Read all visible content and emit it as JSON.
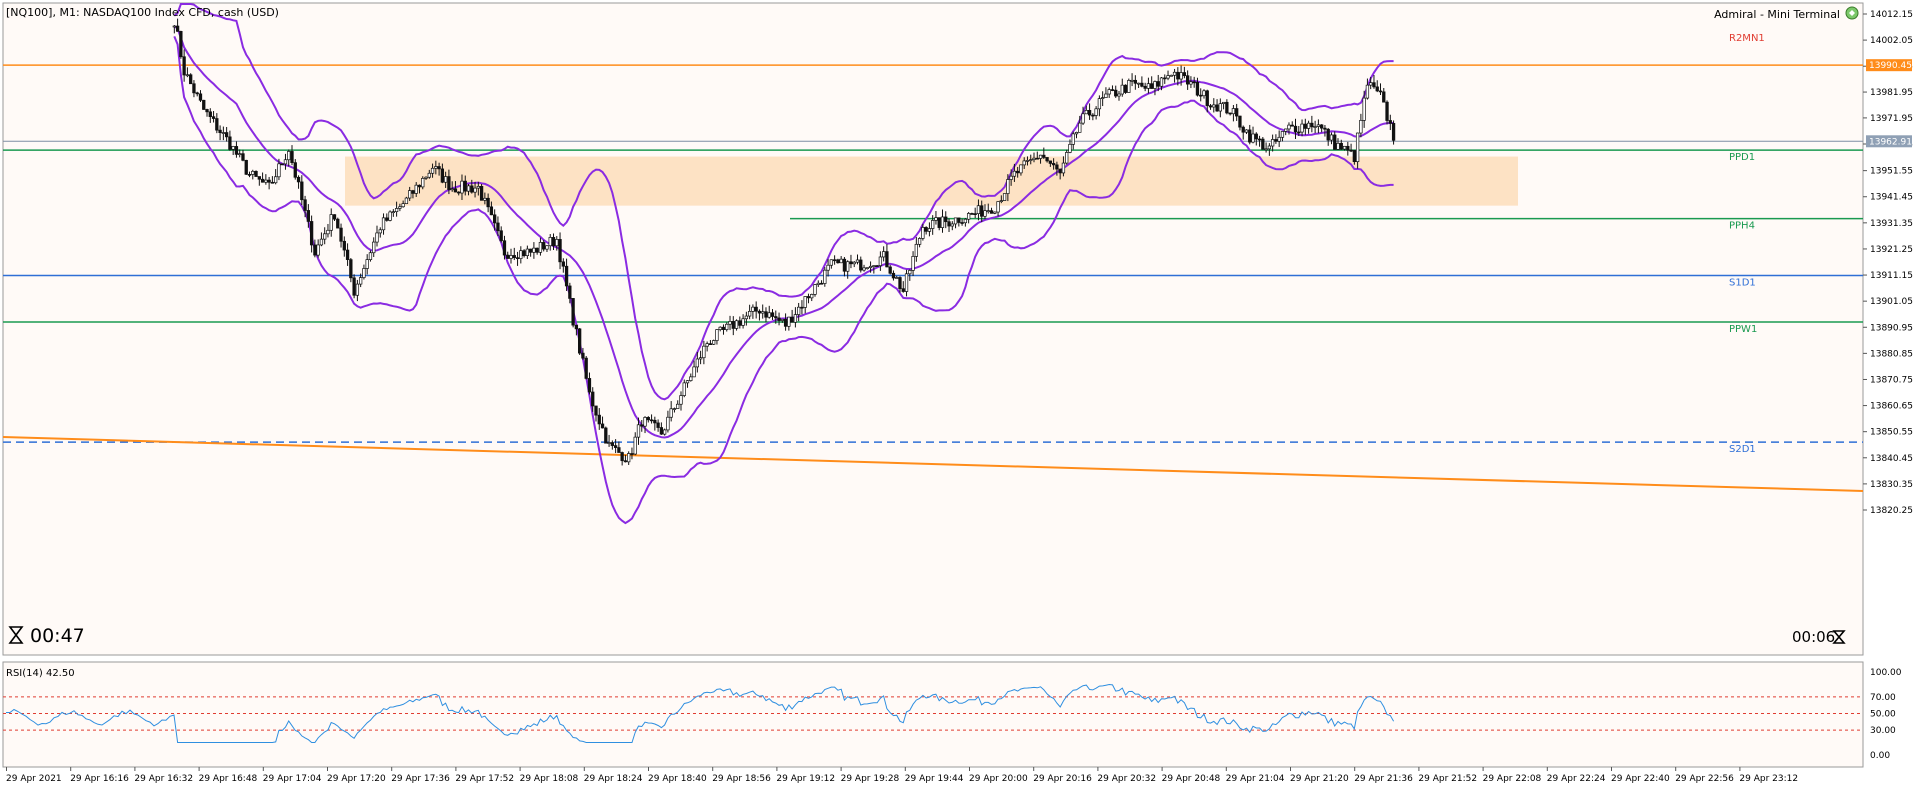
{
  "window": {
    "symbol_label": "[NQ100], M1:  NASDAQ100 Index CFD, cash (USD)",
    "terminal_label": "Admiral - Mini Terminal",
    "timer_left": "00:47",
    "timer_right": "00:06"
  },
  "colors": {
    "background": "#ffffff",
    "chart_bg": "#fffaf7",
    "band": "#8a2be2",
    "zone": "#fde2c4",
    "orange": "#ff8c1a",
    "green_level": "#1a9950",
    "blue_level": "#2f6fd6",
    "red_label": "#e03c31",
    "candle_up": "#ffffff",
    "candle_down": "#111111",
    "rsi_line": "#2f8fe0",
    "rsi_level": "#e03c31"
  },
  "chart_data": [
    {
      "type": "candlestick",
      "panel": "price",
      "ylim": [
        13815,
        14015
      ],
      "y_ticks": [
        "14012.15",
        "14002.05",
        "13991.95",
        "13981.95",
        "13971.95",
        "13961.85",
        "13951.55",
        "13941.45",
        "13931.35",
        "13921.25",
        "13911.15",
        "13901.05",
        "13890.95",
        "13880.85",
        "13870.75",
        "13860.65",
        "13850.55",
        "13840.45",
        "13830.35",
        "13820.25"
      ],
      "x_ticks": [
        "29 Apr 2021",
        "29 Apr 16:16",
        "29 Apr 16:32",
        "29 Apr 16:48",
        "29 Apr 17:04",
        "29 Apr 17:20",
        "29 Apr 17:36",
        "29 Apr 17:52",
        "29 Apr 18:08",
        "29 Apr 18:24",
        "29 Apr 18:40",
        "29 Apr 18:56",
        "29 Apr 19:12",
        "29 Apr 19:28",
        "29 Apr 19:44",
        "29 Apr 20:00",
        "29 Apr 20:16",
        "29 Apr 20:32",
        "29 Apr 20:48",
        "29 Apr 21:04",
        "29 Apr 21:20",
        "29 Apr 21:36",
        "29 Apr 21:52",
        "29 Apr 22:08",
        "29 Apr 22:24",
        "29 Apr 22:40",
        "29 Apr 22:56",
        "29 Apr 23:12"
      ],
      "price_path": [
        {
          "t": "16:47",
          "p": 14010
        },
        {
          "t": "16:50",
          "p": 13990
        },
        {
          "t": "16:56",
          "p": 13975
        },
        {
          "t": "17:04",
          "p": 13962
        },
        {
          "t": "17:10",
          "p": 13950
        },
        {
          "t": "17:16",
          "p": 13945
        },
        {
          "t": "17:22",
          "p": 13960
        },
        {
          "t": "17:30",
          "p": 13920
        },
        {
          "t": "17:36",
          "p": 13935
        },
        {
          "t": "17:42",
          "p": 13905
        },
        {
          "t": "17:50",
          "p": 13930
        },
        {
          "t": "17:58",
          "p": 13940
        },
        {
          "t": "18:06",
          "p": 13953
        },
        {
          "t": "18:12",
          "p": 13945
        },
        {
          "t": "18:20",
          "p": 13945
        },
        {
          "t": "18:28",
          "p": 13920
        },
        {
          "t": "18:36",
          "p": 13920
        },
        {
          "t": "18:44",
          "p": 13925
        },
        {
          "t": "18:48",
          "p": 13900
        },
        {
          "t": "18:54",
          "p": 13865
        },
        {
          "t": "19:00",
          "p": 13845
        },
        {
          "t": "19:06",
          "p": 13840
        },
        {
          "t": "19:10",
          "p": 13855
        },
        {
          "t": "19:16",
          "p": 13850
        },
        {
          "t": "19:22",
          "p": 13865
        },
        {
          "t": "19:30",
          "p": 13885
        },
        {
          "t": "19:38",
          "p": 13892
        },
        {
          "t": "19:46",
          "p": 13898
        },
        {
          "t": "19:54",
          "p": 13892
        },
        {
          "t": "20:02",
          "p": 13905
        },
        {
          "t": "20:08",
          "p": 13915
        },
        {
          "t": "20:16",
          "p": 13915
        },
        {
          "t": "20:24",
          "p": 13918
        },
        {
          "t": "20:30",
          "p": 13905
        },
        {
          "t": "20:36",
          "p": 13930
        },
        {
          "t": "20:44",
          "p": 13932
        },
        {
          "t": "20:52",
          "p": 13935
        },
        {
          "t": "20:58",
          "p": 13938
        },
        {
          "t": "21:04",
          "p": 13950
        },
        {
          "t": "21:12",
          "p": 13958
        },
        {
          "t": "21:18",
          "p": 13950
        },
        {
          "t": "21:24",
          "p": 13970
        },
        {
          "t": "21:32",
          "p": 13980
        },
        {
          "t": "21:40",
          "p": 13985
        },
        {
          "t": "21:46",
          "p": 13983
        },
        {
          "t": "21:52",
          "p": 13990
        },
        {
          "t": "21:58",
          "p": 13985
        },
        {
          "t": "22:04",
          "p": 13978
        },
        {
          "t": "22:10",
          "p": 13975
        },
        {
          "t": "22:16",
          "p": 13965
        },
        {
          "t": "22:22",
          "p": 13960
        },
        {
          "t": "22:28",
          "p": 13968
        },
        {
          "t": "22:36",
          "p": 13970
        },
        {
          "t": "22:42",
          "p": 13962
        },
        {
          "t": "22:48",
          "p": 13957
        },
        {
          "t": "22:52",
          "p": 13985
        },
        {
          "t": "22:56",
          "p": 13980
        },
        {
          "t": "23:00",
          "p": 13965
        }
      ],
      "current_price": "13962.91",
      "levels": [
        {
          "name": "R2MN1",
          "value": 13992.35,
          "label_price": "13990.45"
        },
        {
          "name": "PPD1",
          "value": 13959.5
        },
        {
          "name": "PPH4",
          "value": 13933
        },
        {
          "name": "S1D1",
          "value": 13911
        },
        {
          "name": "PPW1",
          "value": 13893
        },
        {
          "name": "S2D1",
          "value": 13846.5
        }
      ],
      "zone": [
        13938,
        13957
      ]
    },
    {
      "type": "line",
      "panel": "rsi",
      "title": "RSI(14) 42.50",
      "ylim": [
        0,
        100
      ],
      "y_ticks": [
        "100.00",
        "70.00",
        "50.00",
        "30.00",
        "0.00"
      ],
      "levels": [
        70,
        50,
        30
      ]
    }
  ]
}
